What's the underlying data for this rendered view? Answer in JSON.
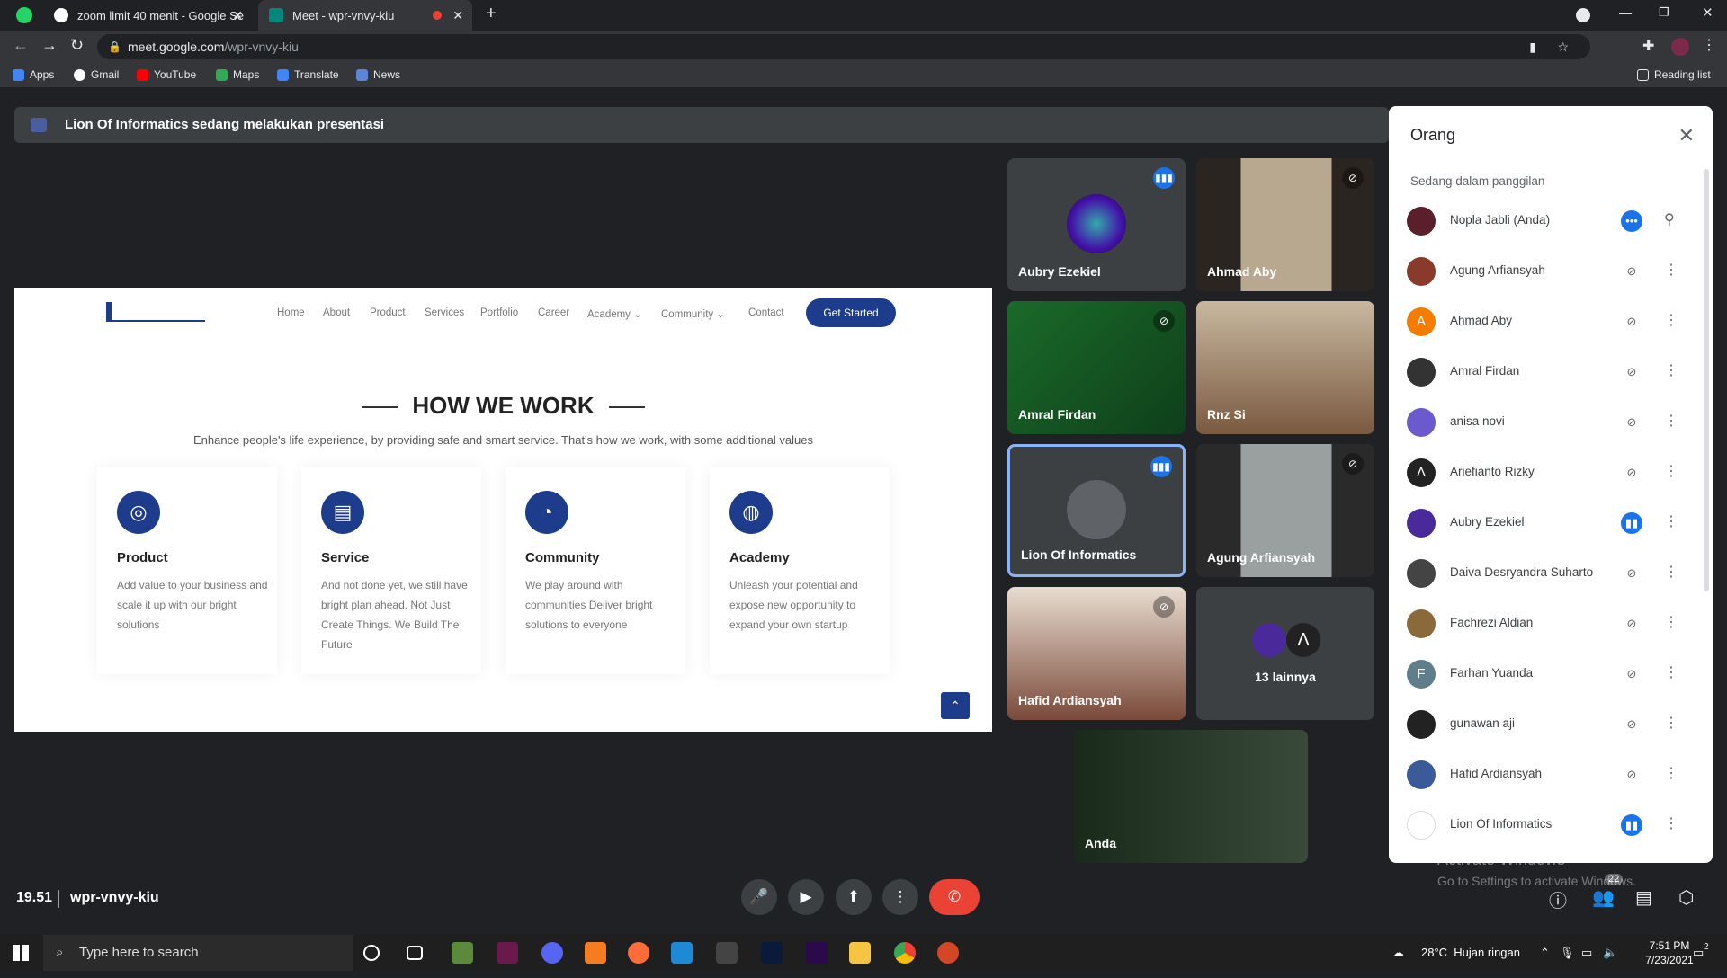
{
  "browser": {
    "tabs": [
      {
        "title": "zoom limit 40 menit - Google Se"
      },
      {
        "title": "Meet - wpr-vnvy-kiu"
      }
    ],
    "url_host": "meet.google.com",
    "url_path": "/wpr-vnvy-kiu",
    "bookmarks": [
      "Apps",
      "Gmail",
      "YouTube",
      "Maps",
      "Translate",
      "News"
    ],
    "reading_list": "Reading list"
  },
  "meet": {
    "banner": "Lion Of Informatics sedang melakukan presentasi",
    "presentation": {
      "nav": [
        "Home",
        "About",
        "Product",
        "Services",
        "Portfolio",
        "Career",
        "Academy ⌄",
        "Community ⌄",
        "Contact"
      ],
      "cta": "Get Started",
      "heading": "HOW WE WORK",
      "subheading": "Enhance people's life experience, by providing safe and smart service. That's how we work, with some additional values",
      "cards": [
        {
          "title": "Product",
          "desc": "Add value to your business and scale it up with our bright solutions",
          "icon": "basketball-icon"
        },
        {
          "title": "Service",
          "desc": "And not done yet, we still have bright plan ahead. Not Just Create Things. We Build The Future",
          "icon": "document-icon"
        },
        {
          "title": "Community",
          "desc": "We play around with communities Deliver bright solutions to everyone",
          "icon": "gauge-icon"
        },
        {
          "title": "Academy",
          "desc": "Unleash your potential and expose new opportunity to expand your own startup",
          "icon": "globe-icon"
        }
      ]
    },
    "tiles": [
      {
        "name": "Aubry Ezekiel",
        "state": "speaking"
      },
      {
        "name": "Ahmad Aby",
        "state": "muted"
      },
      {
        "name": "Amral Firdan",
        "state": "muted"
      },
      {
        "name": "Rnz Si",
        "state": "none"
      },
      {
        "name": "Lion Of Informatics",
        "state": "speaking"
      },
      {
        "name": "Agung Arfiansyah",
        "state": "muted"
      },
      {
        "name": "Hafid Ardiansyah",
        "state": "muted"
      },
      {
        "name": "13 lainnya",
        "state": "none"
      },
      {
        "name": "Anda",
        "state": "none"
      }
    ],
    "time": "19.51",
    "meeting_code": "wpr-vnvy-kiu",
    "people_count": "22"
  },
  "people_panel": {
    "title": "Orang",
    "section": "Sedang dalam panggilan",
    "people": [
      {
        "name": "Nopla Jabli (Anda)",
        "mic": "speaking-dots",
        "avatar_color": "#5a1f2a"
      },
      {
        "name": "Agung Arfiansyah",
        "mic": "muted",
        "avatar_color": "#8a3a2a"
      },
      {
        "name": "Ahmad Aby",
        "mic": "muted",
        "avatar_color": "#f57c00",
        "initial": "A"
      },
      {
        "name": "Amral Firdan",
        "mic": "muted",
        "avatar_color": "#333"
      },
      {
        "name": "anisa novi",
        "mic": "muted",
        "avatar_color": "#6a5acd"
      },
      {
        "name": "Ariefianto Rizky",
        "mic": "muted",
        "avatar_color": "#222",
        "initial": "Λ"
      },
      {
        "name": "Aubry Ezekiel",
        "mic": "speaking",
        "avatar_color": "#4a2a9a"
      },
      {
        "name": "Daiva Desryandra Suharto",
        "mic": "muted",
        "avatar_color": "#444"
      },
      {
        "name": "Fachrezi Aldian",
        "mic": "muted",
        "avatar_color": "#8a6a3a"
      },
      {
        "name": "Farhan Yuanda",
        "mic": "muted",
        "avatar_color": "#607d8b",
        "initial": "F"
      },
      {
        "name": "gunawan aji",
        "mic": "muted",
        "avatar_color": "#222"
      },
      {
        "name": "Hafid Ardiansyah",
        "mic": "muted",
        "avatar_color": "#3a5a9a"
      },
      {
        "name": "Lion Of Informatics",
        "mic": "speaking",
        "avatar_color": "#fff"
      }
    ]
  },
  "watermark": {
    "line1": "Activate Windows",
    "line2": "Go to Settings to activate Windows."
  },
  "taskbar": {
    "search_placeholder": "Type here to search",
    "weather": "28°C  Hujan ringan",
    "clock_time": "7:51 PM",
    "clock_date": "7/23/2021",
    "notif": "2"
  }
}
